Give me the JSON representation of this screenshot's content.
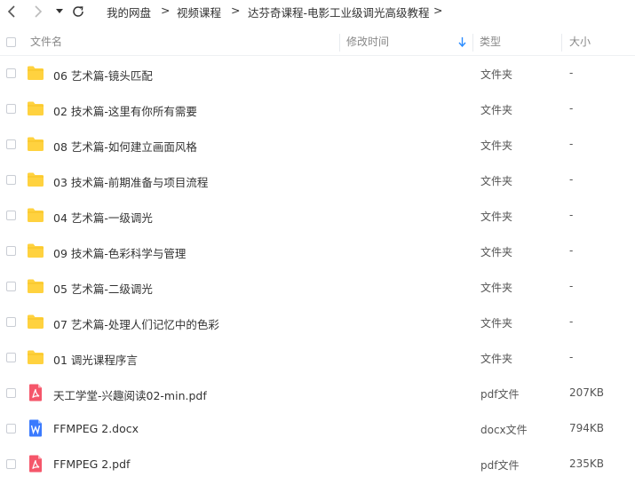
{
  "breadcrumb": {
    "items": [
      "我的网盘",
      "视频课程",
      "达芬奇课程-电影工业级调光高级教程"
    ],
    "separator": ">"
  },
  "columns": {
    "name": "文件名",
    "modified": "修改时间",
    "type": "类型",
    "size": "大小"
  },
  "colors": {
    "folder": "#ffd23f",
    "pdf": "#f5566a",
    "docx": "#3a7afe",
    "sort_arrow": "#2b8cff"
  },
  "files": [
    {
      "name": "06 艺术篇-镜头匹配",
      "type": "文件夹",
      "size": "-",
      "icon": "folder-icon"
    },
    {
      "name": "02 技术篇-这里有你所有需要",
      "type": "文件夹",
      "size": "-",
      "icon": "folder-icon"
    },
    {
      "name": "08 艺术篇-如何建立画面风格",
      "type": "文件夹",
      "size": "-",
      "icon": "folder-icon"
    },
    {
      "name": "03 技术篇-前期准备与项目流程",
      "type": "文件夹",
      "size": "-",
      "icon": "folder-icon"
    },
    {
      "name": "04 艺术篇-一级调光",
      "type": "文件夹",
      "size": "-",
      "icon": "folder-icon"
    },
    {
      "name": "09 技术篇-色彩科学与管理",
      "type": "文件夹",
      "size": "-",
      "icon": "folder-icon"
    },
    {
      "name": "05 艺术篇-二级调光",
      "type": "文件夹",
      "size": "-",
      "icon": "folder-icon"
    },
    {
      "name": "07 艺术篇-处理人们记忆中的色彩",
      "type": "文件夹",
      "size": "-",
      "icon": "folder-icon"
    },
    {
      "name": "01 调光课程序言",
      "type": "文件夹",
      "size": "-",
      "icon": "folder-icon"
    },
    {
      "name": "天工学堂-兴趣阅读02-min.pdf",
      "type": "pdf文件",
      "size": "207KB",
      "icon": "pdf-file-icon"
    },
    {
      "name": "FFMPEG 2.docx",
      "type": "docx文件",
      "size": "794KB",
      "icon": "word-file-icon"
    },
    {
      "name": "FFMPEG 2.pdf",
      "type": "pdf文件",
      "size": "235KB",
      "icon": "pdf-file-icon"
    }
  ]
}
